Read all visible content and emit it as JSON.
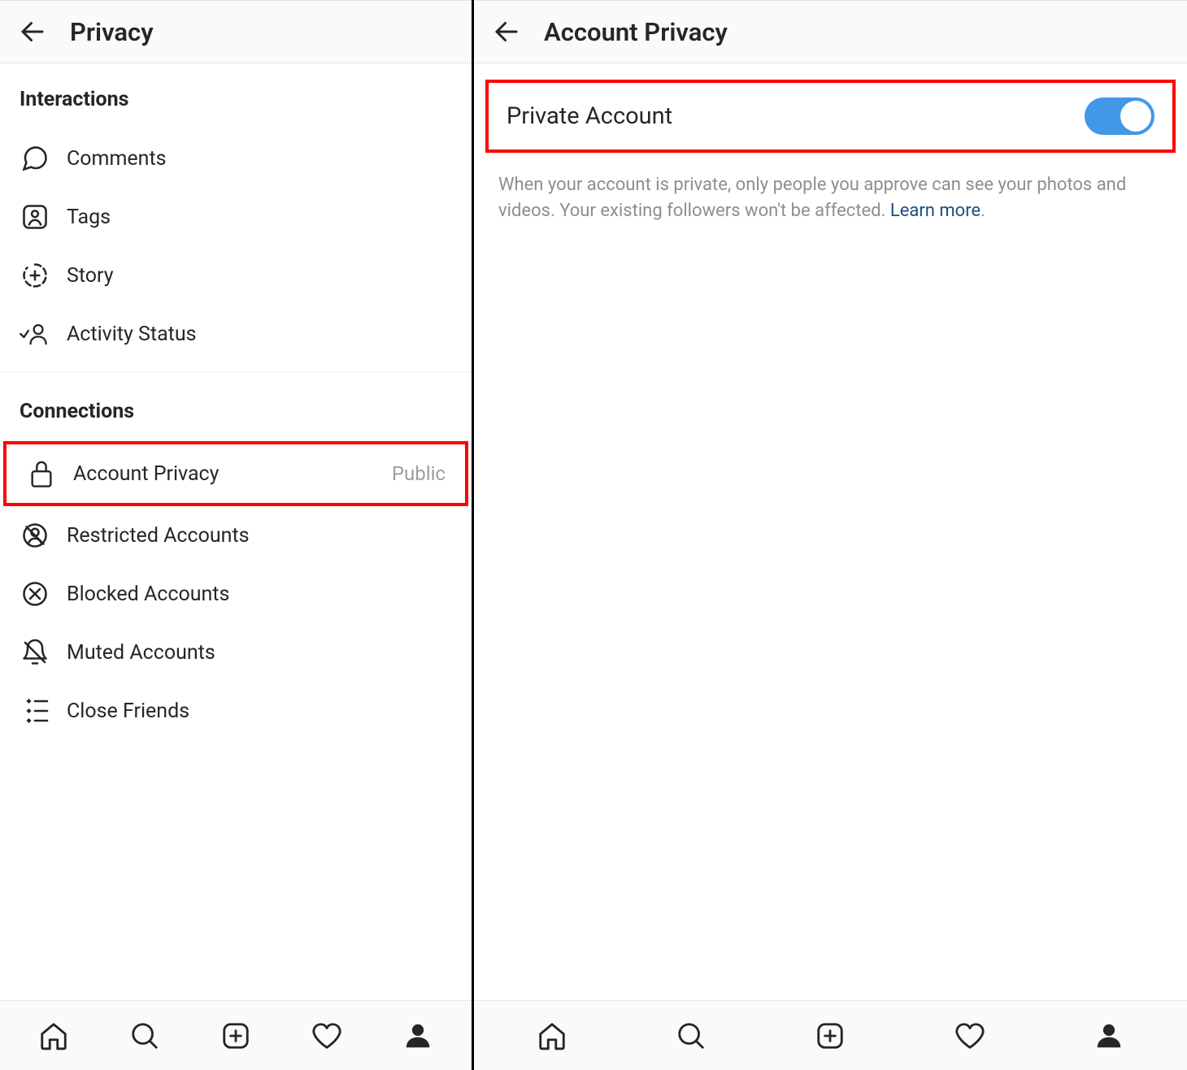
{
  "left": {
    "title": "Privacy",
    "sections": {
      "interactions": {
        "header": "Interactions",
        "items": {
          "comments": "Comments",
          "tags": "Tags",
          "story": "Story",
          "activity_status": "Activity Status"
        }
      },
      "connections": {
        "header": "Connections",
        "items": {
          "account_privacy": {
            "label": "Account Privacy",
            "trailing": "Public"
          },
          "restricted": "Restricted Accounts",
          "blocked": "Blocked Accounts",
          "muted": "Muted Accounts",
          "close_friends": "Close Friends"
        }
      }
    }
  },
  "right": {
    "title": "Account Privacy",
    "private_account_label": "Private Account",
    "private_account_on": true,
    "description": "When your account is private, only people you approve can see your photos and videos. Your existing followers won't be affected. ",
    "learn_more": "Learn more",
    "period": "."
  },
  "colors": {
    "highlight": "#ff0000",
    "accent": "#4298e7"
  }
}
